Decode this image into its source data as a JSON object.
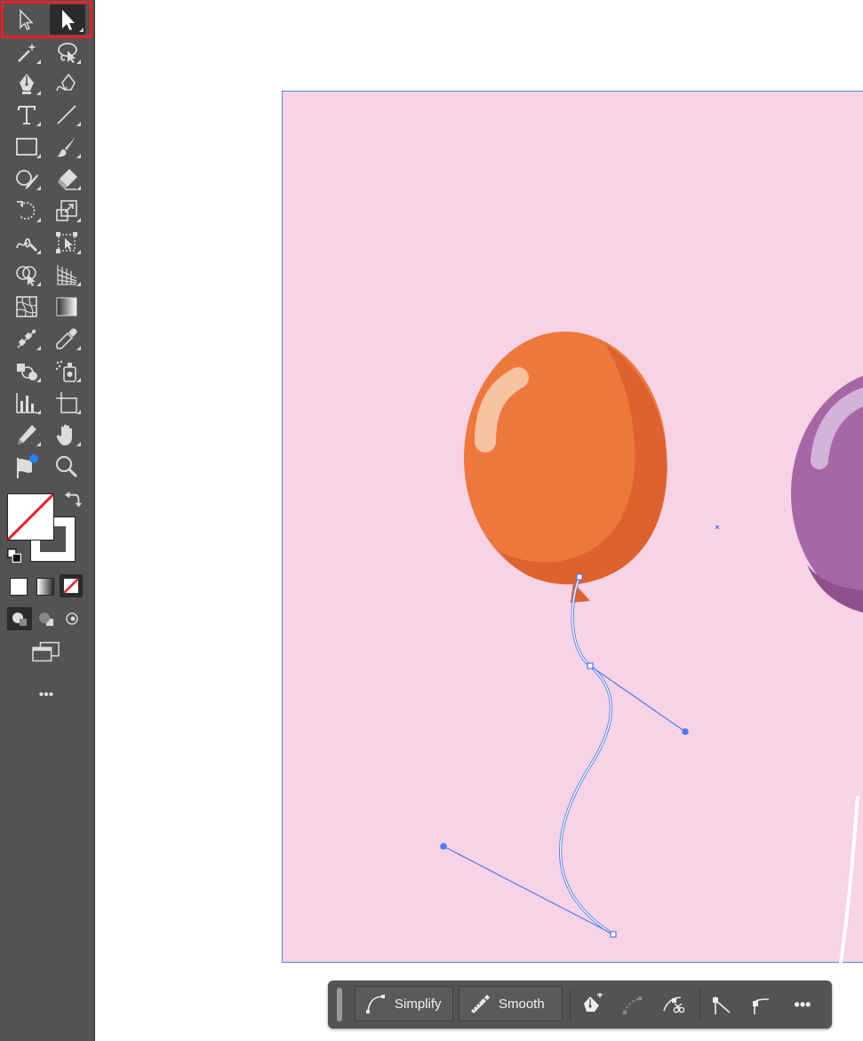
{
  "toolbar": {
    "tools": [
      "selection-tool",
      "direct-selection-tool",
      "magic-wand-tool",
      "lasso-tool",
      "pen-tool",
      "curvature-tool",
      "type-tool",
      "line-segment-tool",
      "rectangle-tool",
      "paintbrush-tool",
      "shaper-tool",
      "eraser-tool",
      "rotate-tool",
      "scale-tool",
      "warp-tool",
      "free-transform-tool",
      "shape-builder-tool",
      "perspective-grid-tool",
      "mesh-tool",
      "gradient-tool",
      "blend-tool",
      "eyedropper-tool",
      "symbol-sprayer-tool",
      "symbol-tool",
      "column-graph-tool",
      "artboard-tool",
      "slice-tool",
      "hand-tool",
      "puppet-warp-tool",
      "zoom-tool"
    ],
    "more_tools_label": "•••"
  },
  "colors": {
    "artboard": "#f7d3e5",
    "balloon_orange": "#ee773b",
    "balloon_orange_shade": "#dc632e",
    "balloon_purple": "#a766a6",
    "selection_blue": "#4d7cf2",
    "highlight_red": "#e8202a"
  },
  "context_bar": {
    "simplify_label": "Simplify",
    "smooth_label": "Smooth",
    "icons": [
      "pen-anchor-icon",
      "convert-anchor-icon",
      "cut-path-icon",
      "corner-anchor-icon",
      "smooth-anchor-icon",
      "more-options-icon"
    ],
    "more_label": "•••"
  }
}
